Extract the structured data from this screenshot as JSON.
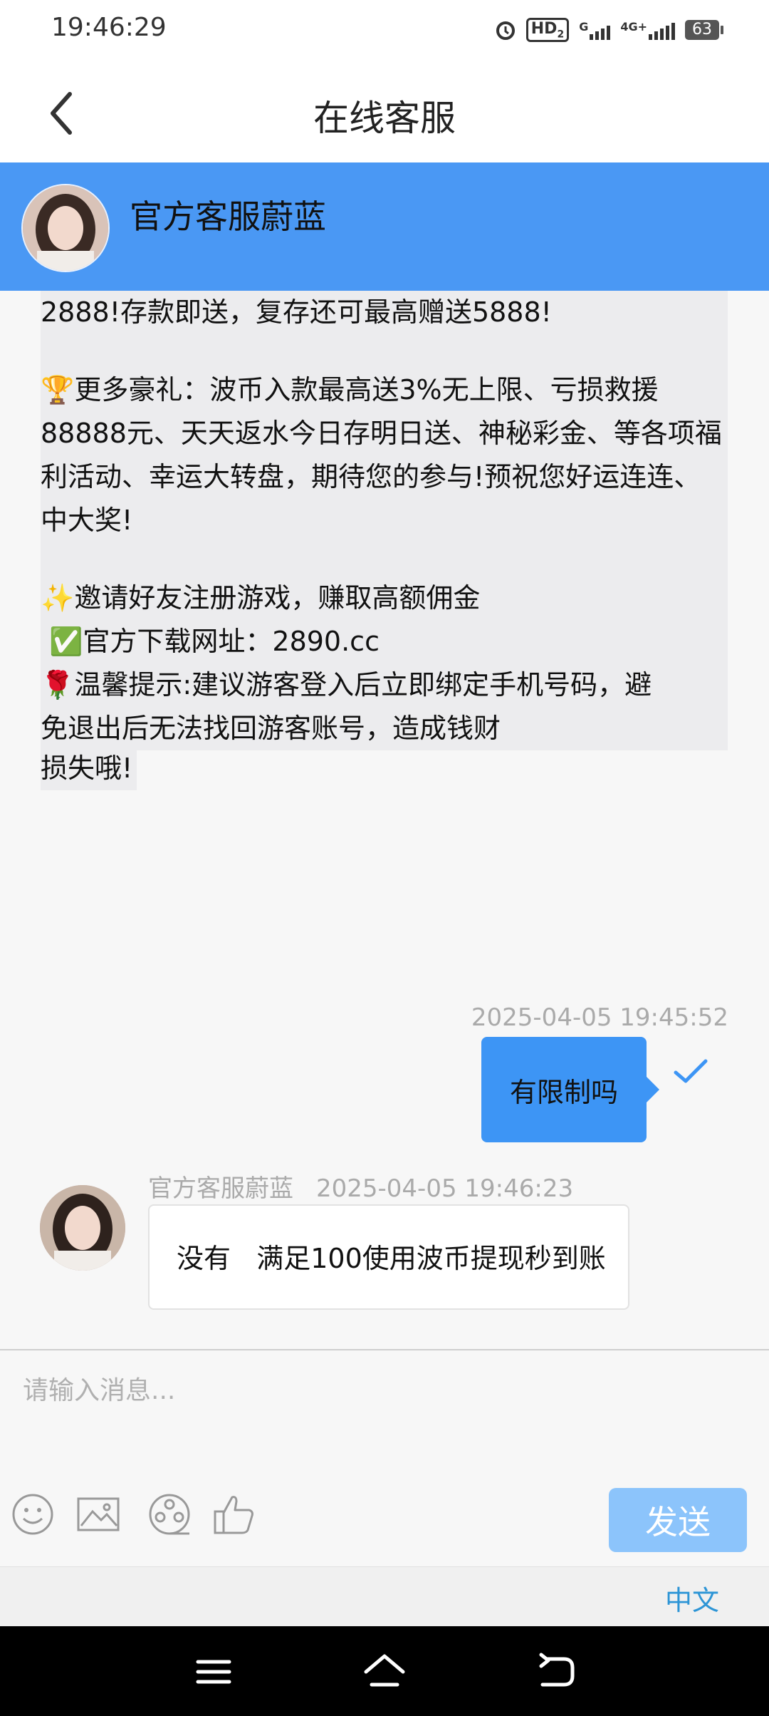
{
  "status_bar": {
    "time": "19:46:29",
    "hd_label": "HD",
    "hd_sub": "2",
    "g_label": "G",
    "net_label": "4G+",
    "battery": "63"
  },
  "nav": {
    "title": "在线客服"
  },
  "agent": {
    "name": "官方客服蔚蓝"
  },
  "messages": {
    "promo": {
      "line_top": "2888!存款即送，复存还可最高赠送5888!",
      "para_more": "🏆更多豪礼：波币入款最高送3%无上限、亏损救援88888元、天天返水今日存明日送、神秘彩金、等各项福利活动、幸运大转盘，期待您的参与!预祝您好运连连、中大奖!",
      "invite": "✨邀请好友注册游戏，赚取高额佣金",
      "download": " ✅官方下载网址：2890.cc",
      "tip": "🌹温馨提示:建议游客登入后立即绑定手机号码，避免退出后无法找回游客账号，造成钱财",
      "tip_end": "损失哦!"
    },
    "user_time": "2025-04-05 19:45:52",
    "user_text": "有限制吗",
    "agent_name": "官方客服蔚蓝",
    "agent_time": "2025-04-05 19:46:23",
    "agent_text": "没有   满足100使用波币提现秒到账"
  },
  "composer": {
    "placeholder": "请输入消息...",
    "send_label": "发送"
  },
  "lang": {
    "label": "中文"
  },
  "colors": {
    "agent_header": "#4a98f4",
    "user_bubble": "#3d95f5",
    "send_button": "#8cc4fb",
    "lang_link": "#2d95d6"
  }
}
